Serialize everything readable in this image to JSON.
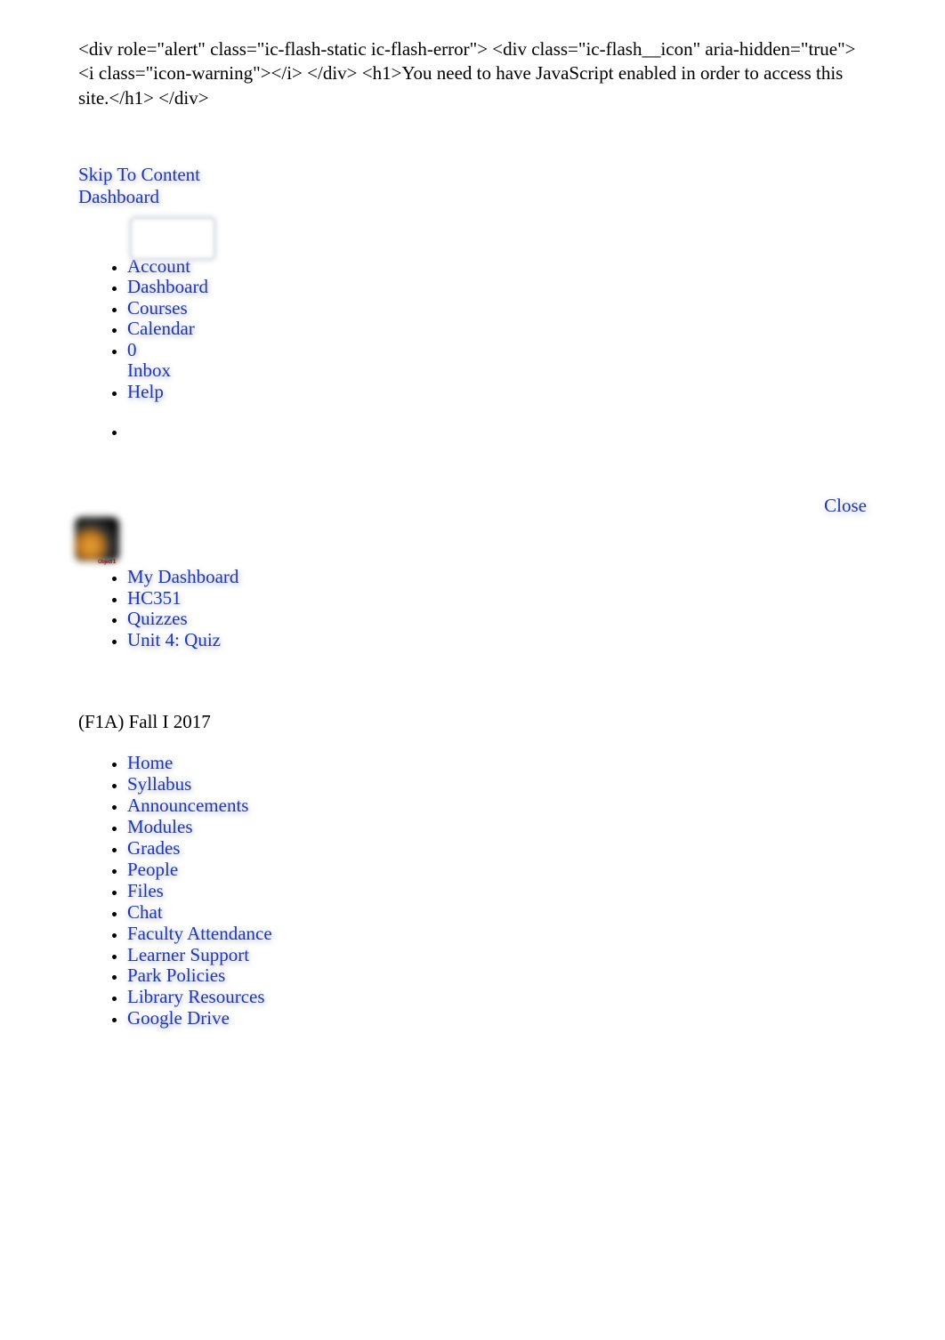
{
  "raw_html_text": "<div role=\"alert\" class=\"ic-flash-static ic-flash-error\"> <div class=\"ic-flash__icon\" aria-hidden=\"true\"> <i class=\"icon-warning\"></i> </div> <h1>You need to have JavaScript enabled in order to access this site.</h1> </div>",
  "skip_to_content": "Skip To Content",
  "dashboard_top": "Dashboard",
  "global_nav": {
    "account": "Account",
    "dashboard": "Dashboard",
    "courses": "Courses",
    "calendar": "Calendar",
    "inbox_count": "0",
    "inbox": "Inbox",
    "help": "Help"
  },
  "close": "Close",
  "logo_tiny": "Object 1",
  "breadcrumb": {
    "my_dashboard": "My Dashboard",
    "course_code": "HC351",
    "quizzes": "Quizzes",
    "quiz_name": "Unit 4: Quiz"
  },
  "term": "(F1A) Fall I 2017",
  "course_nav": {
    "home": "Home",
    "syllabus": "Syllabus",
    "announcements": "Announcements",
    "modules": "Modules",
    "grades": "Grades",
    "people": "People",
    "files": "Files",
    "chat": "Chat",
    "faculty_attendance": "Faculty Attendance",
    "learner_support": "Learner Support",
    "park_policies": "Park Policies",
    "library_resources": "Library Resources",
    "google_drive": "Google Drive"
  }
}
